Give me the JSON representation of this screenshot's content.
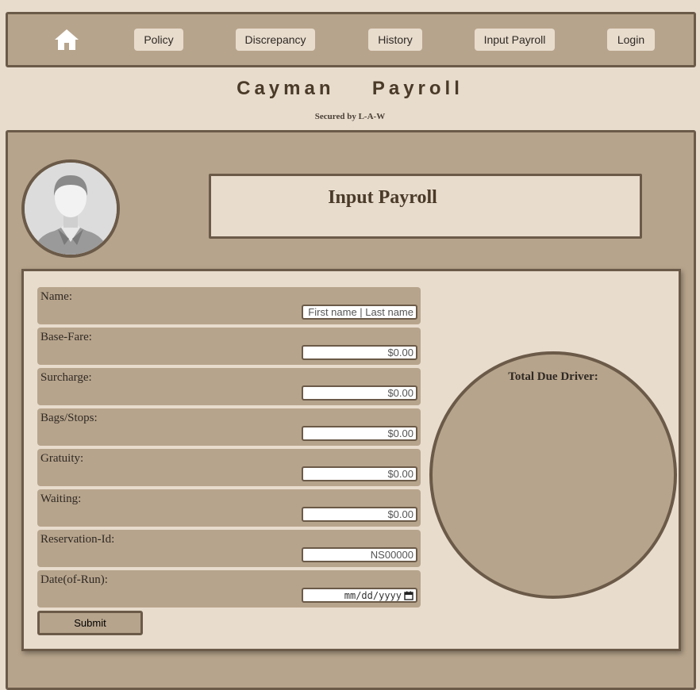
{
  "nav": {
    "home_icon": "home-icon",
    "items": [
      "Policy",
      "Discrepancy",
      "History",
      "Input Payroll",
      "Login"
    ]
  },
  "header": {
    "title": "Cayman  Payroll",
    "subtitle": "Secured by L-A-W"
  },
  "profile": {
    "avatar_icon": "user-avatar-icon"
  },
  "page": {
    "title": "Input Payroll"
  },
  "form": {
    "fields": [
      {
        "label": "Name:",
        "placeholder": "First name | Last name"
      },
      {
        "label": "Base-Fare:",
        "placeholder": "$0.00"
      },
      {
        "label": "Surcharge:",
        "placeholder": "$0.00"
      },
      {
        "label": "Bags/Stops:",
        "placeholder": "$0.00"
      },
      {
        "label": "Gratuity:",
        "placeholder": "$0.00"
      },
      {
        "label": "Waiting:",
        "placeholder": "$0.00"
      },
      {
        "label": "Reservation-Id:",
        "placeholder": "NS00000"
      },
      {
        "label": "Date(of-Run):",
        "placeholder": "mm/dd/yyyy"
      }
    ],
    "submit_label": "Submit"
  },
  "total": {
    "label": "Total Due Driver:"
  },
  "colors": {
    "background": "#e8dccd",
    "panel": "#b7a48c",
    "border": "#6b5a48",
    "heading": "#4a3a28"
  }
}
